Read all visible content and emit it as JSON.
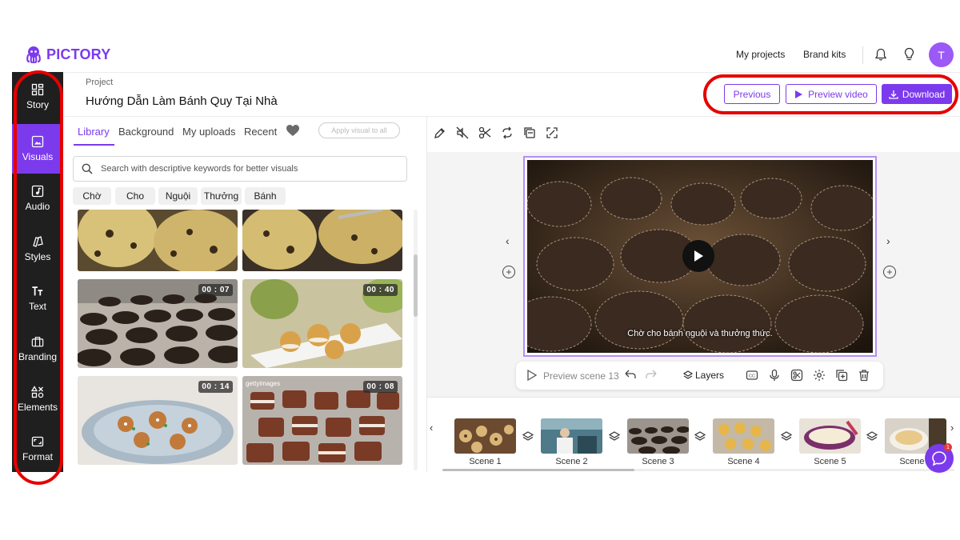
{
  "brand": {
    "name": "PICTORY",
    "accent": "#7c3aed"
  },
  "header": {
    "links": [
      "My projects",
      "Brand kits"
    ],
    "avatar_letter": "T",
    "icons": [
      "bell-icon",
      "lightbulb-icon"
    ]
  },
  "sidebar": {
    "items": [
      {
        "label": "Story",
        "icon": "grid-icon"
      },
      {
        "label": "Visuals",
        "icon": "image-icon",
        "active": true
      },
      {
        "label": "Audio",
        "icon": "music-note-icon"
      },
      {
        "label": "Styles",
        "icon": "styles-icon"
      },
      {
        "label": "Text",
        "icon": "text-icon"
      },
      {
        "label": "Branding",
        "icon": "briefcase-icon"
      },
      {
        "label": "Elements",
        "icon": "shapes-icon"
      },
      {
        "label": "Format",
        "icon": "aspect-ratio-icon"
      }
    ]
  },
  "project": {
    "label": "Project",
    "title": "Hướng Dẫn Làm Bánh Quy Tại Nhà"
  },
  "actions": {
    "previous": "Previous",
    "preview_video": "Preview video",
    "download": "Download"
  },
  "library": {
    "tabs": [
      "Library",
      "Background",
      "My uploads",
      "Recent"
    ],
    "active_tab": "Library",
    "apply_button": "Apply visual to all",
    "search_placeholder": "Search with descriptive keywords for better visuals",
    "chips": [
      "Chờ",
      "Cho",
      "Nguội",
      "Thưởng",
      "Bánh"
    ],
    "thumbnails": [
      {
        "duration": ""
      },
      {
        "duration": ""
      },
      {
        "duration": "00 : 07"
      },
      {
        "duration": "00 : 40"
      },
      {
        "duration": "00 : 14"
      },
      {
        "duration": "00 : 08",
        "watermark": "gettyimages"
      }
    ]
  },
  "preview": {
    "caption": "Chờ cho bánh nguội và thưởng thức.",
    "scene_label": "Preview scene 13",
    "layers_label": "Layers"
  },
  "timeline": {
    "scenes": [
      "Scene 1",
      "Scene 2",
      "Scene 3",
      "Scene 4",
      "Scene 5",
      "Scene 6"
    ]
  },
  "chat": {
    "badge": "1"
  }
}
